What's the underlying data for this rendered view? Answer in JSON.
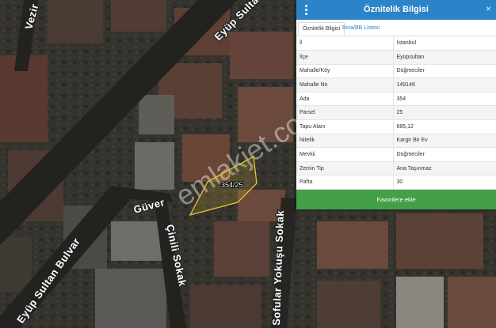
{
  "panel": {
    "title": "Öznitelik Bilgisi",
    "menu_icon": "kebab-menu-icon",
    "close_icon": "×",
    "tabs": [
      {
        "label": "Öznitelik Bilgisi",
        "active": true
      },
      {
        "label": "Bina/BB Listesi",
        "active": false
      }
    ],
    "attributes": [
      {
        "key": "İl",
        "value": "İstanbul"
      },
      {
        "key": "İlçe",
        "value": "Eyüpsultan"
      },
      {
        "key": "Mahalle/Köy",
        "value": "Düğmeciler"
      },
      {
        "key": "Mahalle No",
        "value": "149146"
      },
      {
        "key": "Ada",
        "value": "354"
      },
      {
        "key": "Parsel",
        "value": "25"
      },
      {
        "key": "Tapu Alanı",
        "value": "685,12"
      },
      {
        "key": "Nitelik",
        "value": "Kargir Bir Ev"
      },
      {
        "key": "Mevkii",
        "value": "Düğmeciler"
      },
      {
        "key": "Zemin Tip",
        "value": "Ana Taşınmaz"
      },
      {
        "key": "Pafta",
        "value": "30"
      }
    ],
    "favorite_button": "Favorilere ekle",
    "header_color": "#2a84c7",
    "button_color": "#43a047"
  },
  "map": {
    "parcel_label": "354/25",
    "parcel_color": "#e8c23a",
    "watermark": "emlakjet.com",
    "road_labels": {
      "eyup_sultan_top": "Eyüp Sultan",
      "vezir": "Vezir",
      "eyup_sultan_bulvar": "Eyüp Sultan Bulvar",
      "guven": "Güver",
      "cinili_sokak": "Çinili Sokak",
      "sofular_yokusu": "Sofular Yokuşu Sokak"
    }
  }
}
